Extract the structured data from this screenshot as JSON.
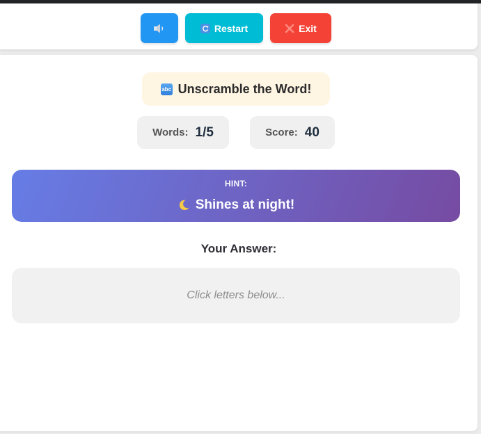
{
  "toolbar": {
    "sound_icon": "speaker-icon",
    "restart_label": "Restart",
    "restart_icon": "restart-icon",
    "exit_label": "Exit",
    "exit_icon": "close-icon",
    "colors": {
      "sound": "#2196f3",
      "restart": "#00bcd4",
      "exit": "#f44336"
    }
  },
  "game": {
    "title": "Unscramble the Word!",
    "title_icon": "abc-icon",
    "stats": {
      "words_label": "Words:",
      "words_value": "1/5",
      "score_label": "Score:",
      "score_value": "40"
    },
    "hint": {
      "label": "HINT:",
      "icon": "crescent-moon-icon",
      "text": "Shines at night!",
      "gradient": [
        "#667de6",
        "#764ba2"
      ]
    },
    "answer": {
      "title": "Your Answer:",
      "placeholder": "Click letters below..."
    }
  }
}
